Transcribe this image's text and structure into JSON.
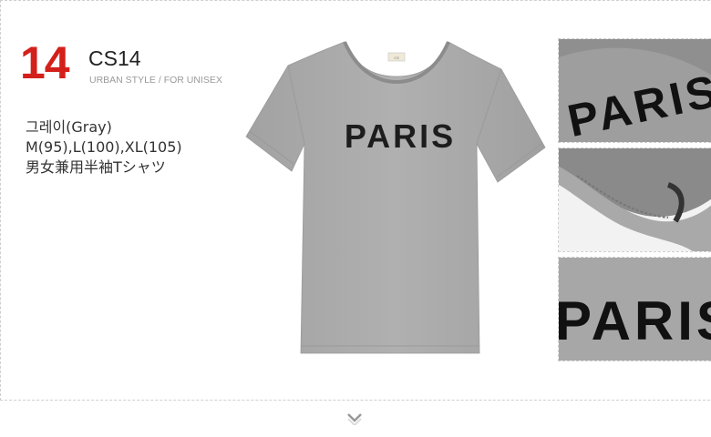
{
  "product": {
    "number": "14",
    "code": "CS14",
    "subtitle": "URBAN STYLE / FOR UNISEX",
    "color_line": "그레이(Gray)",
    "size_line": "M(95),L(100),XL(105)",
    "type_line": "男女兼用半袖Tシャツ",
    "print_text": "PARIS",
    "shirt_color": "#a9a9a9",
    "number_color": "#d4201b"
  },
  "icons": {
    "more": "chevron-down-icon"
  }
}
